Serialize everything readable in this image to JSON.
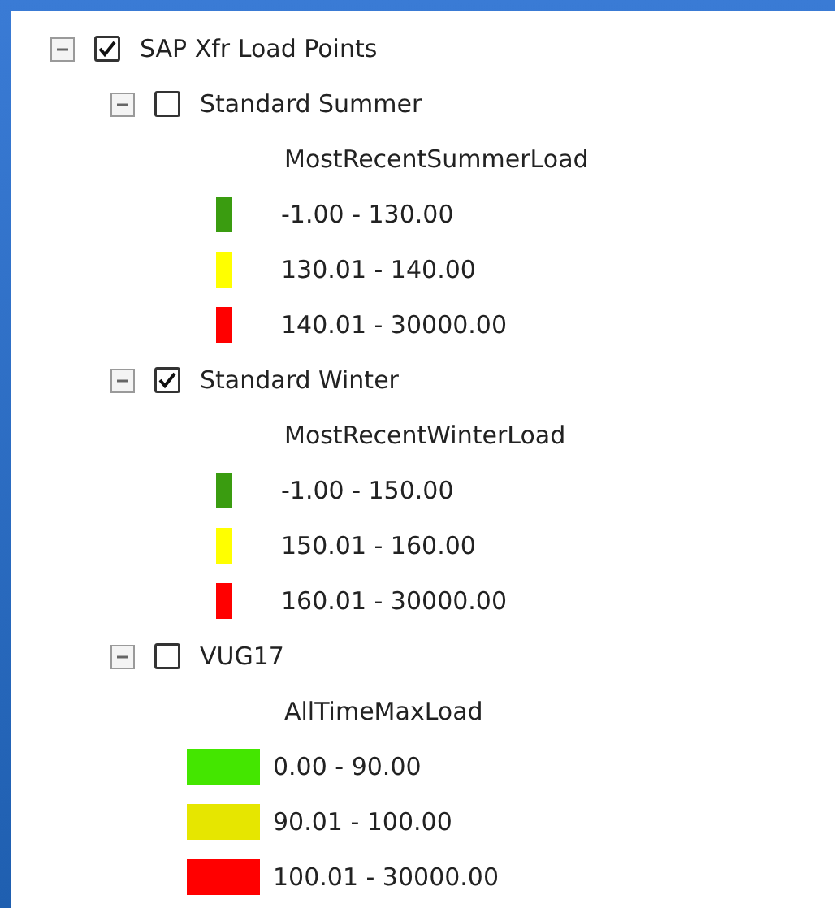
{
  "layer": {
    "label": "SAP Xfr Load Points",
    "checked": true,
    "expanded": true,
    "children": [
      {
        "label": "Standard Summer",
        "checked": false,
        "expanded": true,
        "field": "MostRecentSummerLoad",
        "kind": "bar",
        "classes": [
          {
            "label": "-1.00 - 130.00",
            "color": "#3a9c10"
          },
          {
            "label": "130.01 - 140.00",
            "color": "#ffff00"
          },
          {
            "label": "140.01 - 30000.00",
            "color": "#ff0000"
          }
        ]
      },
      {
        "label": "Standard Winter",
        "checked": true,
        "expanded": true,
        "field": "MostRecentWinterLoad",
        "kind": "bar",
        "classes": [
          {
            "label": "-1.00 - 150.00",
            "color": "#3a9c10"
          },
          {
            "label": "150.01 - 160.00",
            "color": "#ffff00"
          },
          {
            "label": "160.01 - 30000.00",
            "color": "#ff0000"
          }
        ]
      },
      {
        "label": "VUG17",
        "checked": false,
        "expanded": true,
        "field": "AllTimeMaxLoad",
        "kind": "patch",
        "classes": [
          {
            "label": "0.00 - 90.00",
            "color": "#44e600"
          },
          {
            "label": "90.01 - 100.00",
            "color": "#e6e600"
          },
          {
            "label": "100.01 - 30000.00",
            "color": "#ff0000"
          }
        ]
      }
    ]
  }
}
